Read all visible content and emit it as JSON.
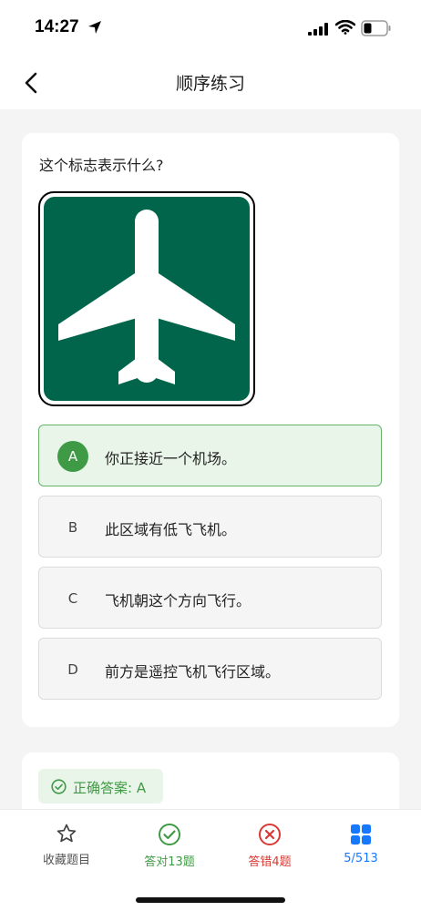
{
  "status_bar": {
    "time": "14:27",
    "icons": [
      "location-arrow-icon",
      "cellular-signal-icon",
      "wifi-icon",
      "battery-icon"
    ]
  },
  "nav": {
    "title": "顺序练习",
    "back_icon": "chevron-left-icon"
  },
  "question": {
    "text": "这个标志表示什么?",
    "sign": {
      "icon": "airplane-icon",
      "background": "#00654a",
      "symbol_color": "#ffffff"
    },
    "options": [
      {
        "letter": "A",
        "text": "你正接近一个机场。",
        "state": "correct"
      },
      {
        "letter": "B",
        "text": "此区域有低飞飞机。",
        "state": "default"
      },
      {
        "letter": "C",
        "text": "飞机朝这个方向飞行。",
        "state": "default"
      },
      {
        "letter": "D",
        "text": "前方是遥控飞机飞行区域。",
        "state": "default"
      }
    ]
  },
  "answer": {
    "text": "正确答案: A",
    "icon": "check-circle-icon"
  },
  "bottom_bar": {
    "favorite": {
      "label": "收藏题目",
      "icon": "star-icon"
    },
    "correct": {
      "label": "答对13题",
      "icon": "check-circle-icon"
    },
    "wrong": {
      "label": "答错4题",
      "icon": "x-circle-icon"
    },
    "progress": {
      "label": "5/513",
      "icon": "grid-icon"
    }
  },
  "colors": {
    "accent_green": "#3f9a45",
    "error_red": "#d93a33",
    "link_blue": "#1677ff",
    "sign_green": "#00654a"
  }
}
